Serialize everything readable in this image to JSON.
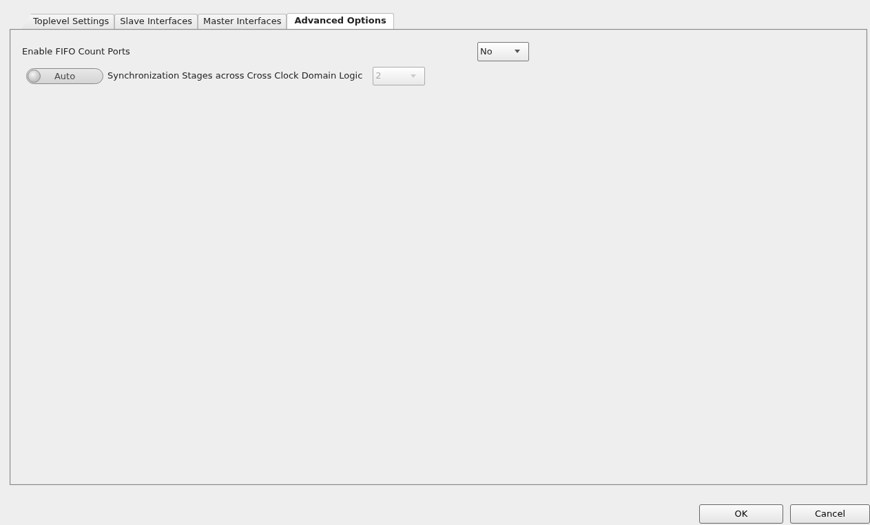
{
  "tabs": [
    {
      "label": "Toplevel Settings",
      "selected": false
    },
    {
      "label": "Slave Interfaces",
      "selected": false
    },
    {
      "label": "Master Interfaces",
      "selected": false
    },
    {
      "label": "Advanced Options",
      "selected": true
    }
  ],
  "options": [
    {
      "kind": "select",
      "label": "Enable FIFO Count Ports",
      "value": "No",
      "disabled": false
    },
    {
      "kind": "auto-select",
      "toggle": {
        "label": "Auto",
        "on": false
      },
      "label": "Synchronization Stages across Cross Clock Domain Logic",
      "value": "2",
      "disabled": true
    }
  ],
  "buttons": [
    "OK",
    "Cancel"
  ]
}
